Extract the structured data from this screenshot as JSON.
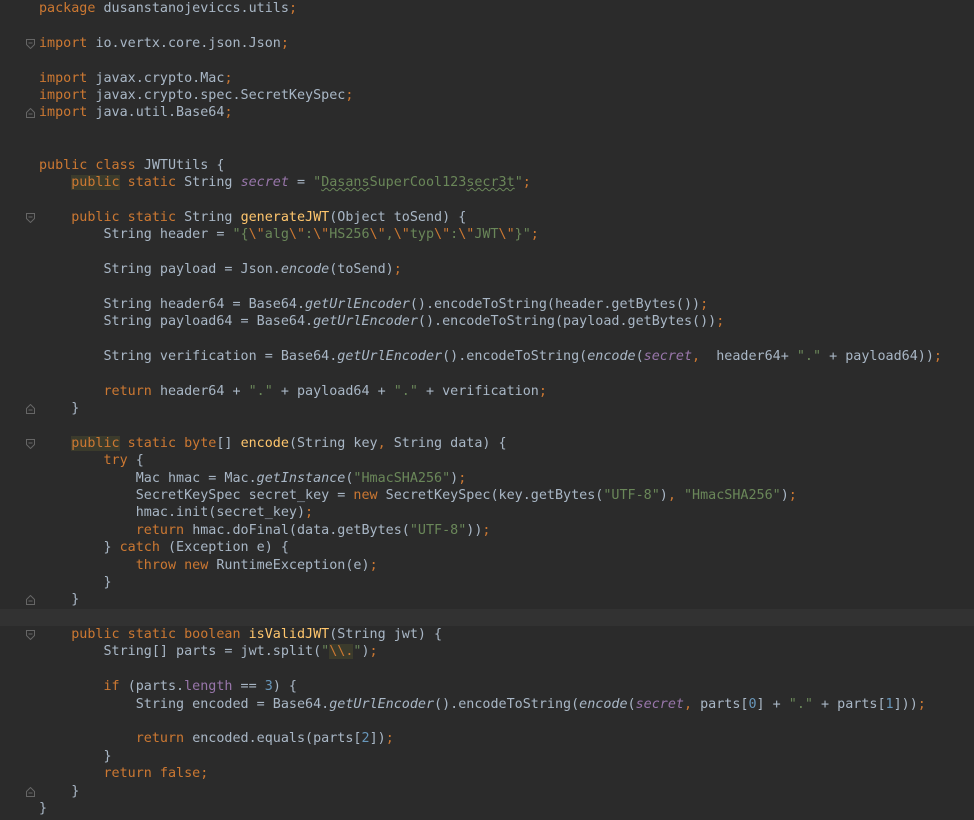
{
  "editor": {
    "language": "java",
    "theme_colors": {
      "background": "#2b2b2b",
      "current_line": "#323232",
      "default_text": "#a9b7c6",
      "keyword": "#cc7832",
      "string": "#6a8759",
      "number": "#6897bb",
      "field": "#9876aa",
      "method_declaration": "#ffc66d"
    },
    "lines": [
      {
        "fold": "",
        "tokens": [
          {
            "t": "package ",
            "c": "kw"
          },
          {
            "t": "dusanstanojeviccs.utils"
          },
          {
            "t": ";",
            "c": "kw"
          }
        ]
      },
      {
        "fold": "",
        "tokens": []
      },
      {
        "fold": "open",
        "tokens": [
          {
            "t": "import ",
            "c": "kw"
          },
          {
            "t": "io.vertx.core.json.Json"
          },
          {
            "t": ";",
            "c": "kw"
          }
        ]
      },
      {
        "fold": "",
        "tokens": []
      },
      {
        "fold": "",
        "tokens": [
          {
            "t": "import ",
            "c": "kw"
          },
          {
            "t": "javax.crypto.Mac"
          },
          {
            "t": ";",
            "c": "kw"
          }
        ]
      },
      {
        "fold": "",
        "tokens": [
          {
            "t": "import ",
            "c": "kw"
          },
          {
            "t": "javax.crypto.spec.SecretKeySpec"
          },
          {
            "t": ";",
            "c": "kw"
          }
        ]
      },
      {
        "fold": "close",
        "tokens": [
          {
            "t": "import ",
            "c": "kw"
          },
          {
            "t": "java.util.Base64"
          },
          {
            "t": ";",
            "c": "kw"
          }
        ]
      },
      {
        "fold": "",
        "tokens": []
      },
      {
        "fold": "",
        "tokens": []
      },
      {
        "fold": "",
        "tokens": [
          {
            "t": "public class ",
            "c": "kw"
          },
          {
            "t": "JWTUtils {"
          }
        ]
      },
      {
        "fold": "",
        "tokens": [
          {
            "t": "    "
          },
          {
            "t": "public",
            "c": "kw hl"
          },
          {
            "t": " static ",
            "c": "kw"
          },
          {
            "t": "String "
          },
          {
            "t": "secret",
            "c": "fld"
          },
          {
            "t": " = "
          },
          {
            "t": "\"",
            "c": "str"
          },
          {
            "t": "Dasans",
            "c": "str typo"
          },
          {
            "t": "SuperCool123",
            "c": "str"
          },
          {
            "t": "secr3t",
            "c": "str typo"
          },
          {
            "t": "\"",
            "c": "str"
          },
          {
            "t": ";",
            "c": "kw"
          }
        ]
      },
      {
        "fold": "",
        "tokens": []
      },
      {
        "fold": "open",
        "tokens": [
          {
            "t": "    "
          },
          {
            "t": "public static ",
            "c": "kw"
          },
          {
            "t": "String "
          },
          {
            "t": "generateJWT",
            "c": "fn"
          },
          {
            "t": "(Object toSend) {"
          }
        ]
      },
      {
        "fold": "",
        "tokens": [
          {
            "t": "        String header = "
          },
          {
            "t": "\"{",
            "c": "str"
          },
          {
            "t": "\\\"",
            "c": "esc"
          },
          {
            "t": "alg",
            "c": "str"
          },
          {
            "t": "\\\"",
            "c": "esc"
          },
          {
            "t": ":",
            "c": "str"
          },
          {
            "t": "\\\"",
            "c": "esc"
          },
          {
            "t": "HS256",
            "c": "str"
          },
          {
            "t": "\\\"",
            "c": "esc"
          },
          {
            "t": ",",
            "c": "str"
          },
          {
            "t": "\\\"",
            "c": "esc"
          },
          {
            "t": "typ",
            "c": "str"
          },
          {
            "t": "\\\"",
            "c": "esc"
          },
          {
            "t": ":",
            "c": "str"
          },
          {
            "t": "\\\"",
            "c": "esc"
          },
          {
            "t": "JWT",
            "c": "str"
          },
          {
            "t": "\\\"",
            "c": "esc"
          },
          {
            "t": "}\"",
            "c": "str"
          },
          {
            "t": ";",
            "c": "kw"
          }
        ]
      },
      {
        "fold": "",
        "tokens": []
      },
      {
        "fold": "",
        "tokens": [
          {
            "t": "        String payload = Json."
          },
          {
            "t": "encode",
            "c": "st"
          },
          {
            "t": "(toSend)"
          },
          {
            "t": ";",
            "c": "kw"
          }
        ]
      },
      {
        "fold": "",
        "tokens": []
      },
      {
        "fold": "",
        "tokens": [
          {
            "t": "        String header64 = Base64."
          },
          {
            "t": "getUrlEncoder",
            "c": "st"
          },
          {
            "t": "().encodeToString(header.getBytes())"
          },
          {
            "t": ";",
            "c": "kw"
          }
        ]
      },
      {
        "fold": "",
        "tokens": [
          {
            "t": "        String payload64 = Base64."
          },
          {
            "t": "getUrlEncoder",
            "c": "st"
          },
          {
            "t": "().encodeToString(payload.getBytes())"
          },
          {
            "t": ";",
            "c": "kw"
          }
        ]
      },
      {
        "fold": "",
        "tokens": []
      },
      {
        "fold": "",
        "tokens": [
          {
            "t": "        String verification = Base64."
          },
          {
            "t": "getUrlEncoder",
            "c": "st"
          },
          {
            "t": "().encodeToString("
          },
          {
            "t": "encode",
            "c": "st"
          },
          {
            "t": "("
          },
          {
            "t": "secret",
            "c": "fld"
          },
          {
            "t": ",",
            "c": "kw"
          },
          {
            "t": "  header64+ "
          },
          {
            "t": "\".\"",
            "c": "str"
          },
          {
            "t": " + payload64))"
          },
          {
            "t": ";",
            "c": "kw"
          }
        ]
      },
      {
        "fold": "",
        "tokens": []
      },
      {
        "fold": "",
        "tokens": [
          {
            "t": "        "
          },
          {
            "t": "return ",
            "c": "kw"
          },
          {
            "t": "header64 + "
          },
          {
            "t": "\".\"",
            "c": "str"
          },
          {
            "t": " + payload64 + "
          },
          {
            "t": "\".\"",
            "c": "str"
          },
          {
            "t": " + verification"
          },
          {
            "t": ";",
            "c": "kw"
          }
        ]
      },
      {
        "fold": "close",
        "tokens": [
          {
            "t": "    }"
          }
        ]
      },
      {
        "fold": "",
        "tokens": []
      },
      {
        "fold": "open",
        "tokens": [
          {
            "t": "    "
          },
          {
            "t": "public",
            "c": "kw hl"
          },
          {
            "t": " static ",
            "c": "kw"
          },
          {
            "t": "byte",
            "c": "kw"
          },
          {
            "t": "[] "
          },
          {
            "t": "encode",
            "c": "fn"
          },
          {
            "t": "(String key"
          },
          {
            "t": ",",
            "c": "kw"
          },
          {
            "t": " String data) {"
          }
        ]
      },
      {
        "fold": "",
        "tokens": [
          {
            "t": "        "
          },
          {
            "t": "try ",
            "c": "kw"
          },
          {
            "t": "{"
          }
        ]
      },
      {
        "fold": "",
        "tokens": [
          {
            "t": "            Mac hmac = Mac."
          },
          {
            "t": "getInstance",
            "c": "st"
          },
          {
            "t": "("
          },
          {
            "t": "\"HmacSHA256\"",
            "c": "str"
          },
          {
            "t": ")"
          },
          {
            "t": ";",
            "c": "kw"
          }
        ]
      },
      {
        "fold": "",
        "tokens": [
          {
            "t": "            SecretKeySpec secret_key = "
          },
          {
            "t": "new ",
            "c": "kw"
          },
          {
            "t": "SecretKeySpec(key.getBytes("
          },
          {
            "t": "\"UTF-8\"",
            "c": "str"
          },
          {
            "t": ")"
          },
          {
            "t": ",",
            "c": "kw"
          },
          {
            "t": " "
          },
          {
            "t": "\"HmacSHA256\"",
            "c": "str"
          },
          {
            "t": ")"
          },
          {
            "t": ";",
            "c": "kw"
          }
        ]
      },
      {
        "fold": "",
        "tokens": [
          {
            "t": "            hmac.init(secret_key)"
          },
          {
            "t": ";",
            "c": "kw"
          }
        ]
      },
      {
        "fold": "",
        "tokens": [
          {
            "t": "            "
          },
          {
            "t": "return ",
            "c": "kw"
          },
          {
            "t": "hmac.doFinal(data.getBytes("
          },
          {
            "t": "\"UTF-8\"",
            "c": "str"
          },
          {
            "t": "))"
          },
          {
            "t": ";",
            "c": "kw"
          }
        ]
      },
      {
        "fold": "",
        "tokens": [
          {
            "t": "        } "
          },
          {
            "t": "catch ",
            "c": "kw"
          },
          {
            "t": "(Exception e) {"
          }
        ]
      },
      {
        "fold": "",
        "tokens": [
          {
            "t": "            "
          },
          {
            "t": "throw new ",
            "c": "kw"
          },
          {
            "t": "RuntimeException(e)"
          },
          {
            "t": ";",
            "c": "kw"
          }
        ]
      },
      {
        "fold": "",
        "tokens": [
          {
            "t": "        }"
          }
        ]
      },
      {
        "fold": "close",
        "tokens": [
          {
            "t": "    }"
          }
        ]
      },
      {
        "fold": "",
        "current": true,
        "tokens": []
      },
      {
        "fold": "open",
        "tokens": [
          {
            "t": "    "
          },
          {
            "t": "public static ",
            "c": "kw"
          },
          {
            "t": "boolean ",
            "c": "kw"
          },
          {
            "t": "isValidJWT",
            "c": "fn"
          },
          {
            "t": "(String jwt) {"
          }
        ]
      },
      {
        "fold": "",
        "tokens": [
          {
            "t": "        String[] parts = jwt.split("
          },
          {
            "t": "\"",
            "c": "str"
          },
          {
            "t": "\\\\.",
            "c": "esc hl"
          },
          {
            "t": "\"",
            "c": "str"
          },
          {
            "t": ")"
          },
          {
            "t": ";",
            "c": "kw"
          }
        ]
      },
      {
        "fold": "",
        "tokens": []
      },
      {
        "fold": "",
        "tokens": [
          {
            "t": "        "
          },
          {
            "t": "if ",
            "c": "kw"
          },
          {
            "t": "(parts."
          },
          {
            "t": "length",
            "c": "fldp"
          },
          {
            "t": " == "
          },
          {
            "t": "3",
            "c": "num"
          },
          {
            "t": ") {"
          }
        ]
      },
      {
        "fold": "",
        "tokens": [
          {
            "t": "            String encoded = Base64."
          },
          {
            "t": "getUrlEncoder",
            "c": "st"
          },
          {
            "t": "().encodeToString("
          },
          {
            "t": "encode",
            "c": "st"
          },
          {
            "t": "("
          },
          {
            "t": "secret",
            "c": "fld"
          },
          {
            "t": ",",
            "c": "kw"
          },
          {
            "t": " parts["
          },
          {
            "t": "0",
            "c": "num"
          },
          {
            "t": "] + "
          },
          {
            "t": "\".\"",
            "c": "str"
          },
          {
            "t": " + parts["
          },
          {
            "t": "1",
            "c": "num"
          },
          {
            "t": "]))"
          },
          {
            "t": ";",
            "c": "kw"
          }
        ]
      },
      {
        "fold": "",
        "tokens": []
      },
      {
        "fold": "",
        "tokens": [
          {
            "t": "            "
          },
          {
            "t": "return ",
            "c": "kw"
          },
          {
            "t": "encoded.equals(parts["
          },
          {
            "t": "2",
            "c": "num"
          },
          {
            "t": "])"
          },
          {
            "t": ";",
            "c": "kw"
          }
        ]
      },
      {
        "fold": "",
        "tokens": [
          {
            "t": "        }"
          }
        ]
      },
      {
        "fold": "",
        "tokens": [
          {
            "t": "        "
          },
          {
            "t": "return false",
            "c": "kw"
          },
          {
            "t": ";",
            "c": "kw"
          }
        ]
      },
      {
        "fold": "close",
        "tokens": [
          {
            "t": "    }"
          }
        ]
      },
      {
        "fold": "",
        "tokens": [
          {
            "t": "}"
          }
        ]
      }
    ]
  }
}
